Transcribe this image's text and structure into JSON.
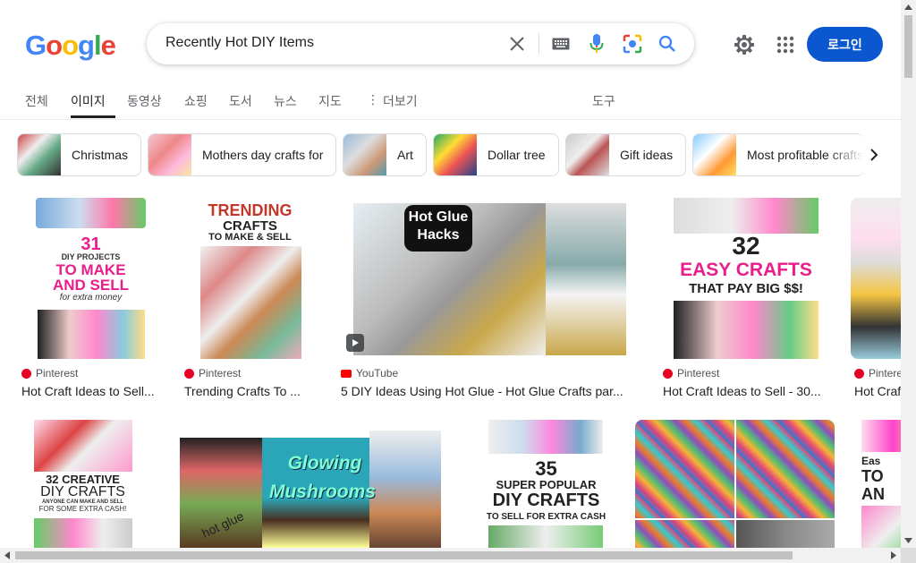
{
  "search": {
    "query": "Recently Hot DIY Items"
  },
  "header": {
    "login_label": "로그인"
  },
  "tabs": [
    {
      "label": "전체"
    },
    {
      "label": "이미지"
    },
    {
      "label": "동영상"
    },
    {
      "label": "쇼핑"
    },
    {
      "label": "도서"
    },
    {
      "label": "뉴스"
    },
    {
      "label": "지도"
    },
    {
      "label": "더보기"
    }
  ],
  "tools_label": "도구",
  "chips": [
    {
      "label": "Christmas"
    },
    {
      "label": "Mothers day crafts for"
    },
    {
      "label": "Art"
    },
    {
      "label": "Dollar tree"
    },
    {
      "label": "Gift ideas"
    },
    {
      "label": "Most profitable crafts"
    }
  ],
  "results_row1": [
    {
      "source": "Pinterest",
      "title": "Hot Craft Ideas to Sell...",
      "img": {
        "a": "31",
        "b": "DIY PROJECTS",
        "c": "TO MAKE",
        "d": "AND SELL",
        "e": "for extra money"
      }
    },
    {
      "source": "Pinterest",
      "title": "Trending Crafts To ...",
      "img": {
        "a": "TRENDING",
        "b": "CRAFTS",
        "c": "TO MAKE & SELL"
      }
    },
    {
      "source": "YouTube",
      "title": "5 DIY Ideas Using Hot Glue - Hot Glue Crafts par...",
      "img": {
        "a": "Hot Glue",
        "b": "Hacks"
      }
    },
    {
      "source": "Pinterest",
      "title": "Hot Craft Ideas to Sell - 30...",
      "img": {
        "a": "32",
        "b": "EASY CRAFTS",
        "c": "THAT PAY BIG $$!"
      }
    },
    {
      "source": "Pintere",
      "title": "Hot Craf"
    }
  ],
  "results_row2": [
    {
      "img": {
        "a": "32 CREATIVE",
        "b": "DIY CRAFTS",
        "c": "ANYONE CAN MAKE AND SELL",
        "d": "FOR SOME EXTRA CASH!"
      }
    },
    {
      "img": {
        "a": "Glowing",
        "b": "Mushrooms",
        "c": "hot glue"
      }
    },
    {
      "img": {
        "a": "35",
        "b": "SUPER POPULAR",
        "c": "DIY CRAFTS",
        "d": "TO SELL FOR EXTRA CASH"
      }
    },
    {
      "img": {}
    },
    {
      "img": {
        "a": "Eas",
        "b": "TO",
        "c": "AN"
      }
    }
  ]
}
